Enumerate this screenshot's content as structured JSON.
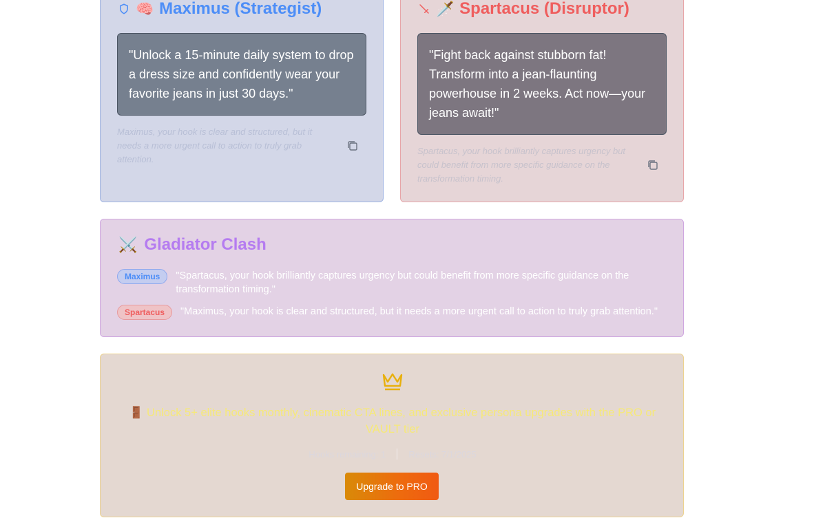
{
  "maximus": {
    "emoji": "🧠",
    "title": "Maximus (Strategist)",
    "hook": "\"Unlock a 15-minute daily system to drop a dress size and confidently wear your favorite jeans in just 30 days.\"",
    "critique": "Maximus, your hook is clear and structured, but it needs a more urgent call to action to truly grab attention.",
    "accent_color": "#4d8ef7"
  },
  "spartacus": {
    "emoji": "🗡️",
    "title": "Spartacus (Disruptor)",
    "hook": "\"Fight back against stubborn fat! Transform into a jean-flaunting powerhouse in 2 weeks. Act now—your jeans await!\"",
    "critique": "Spartacus, your hook brilliantly captures urgency but could benefit from more specific guidance on the transformation timing.",
    "accent_color": "#ef5e5e"
  },
  "clash": {
    "emoji": "⚔️",
    "title": "Gladiator Clash",
    "rows": [
      {
        "speaker": "Maximus",
        "text": "\"Spartacus, your hook brilliantly captures urgency but could benefit from more specific guidance on the transformation timing.\""
      },
      {
        "speaker": "Spartacus",
        "text": "\"Maximus, your hook is clear and structured, but it needs a more urgent call to action to truly grab attention.\""
      }
    ],
    "accent_color": "#b57cf0"
  },
  "upgrade": {
    "promo": "🚪 Unlock 5+ elite hooks monthly, cinematic CTA lines, and exclusive persona upgrades with the PRO or VAULT tier",
    "hooks_remaining_label": "Hooks remaining:",
    "hooks_remaining_value": "1",
    "resets": "Resets: 7/1/2025",
    "button_label": "Upgrade to PRO",
    "accent_color": "#e8b00c"
  }
}
